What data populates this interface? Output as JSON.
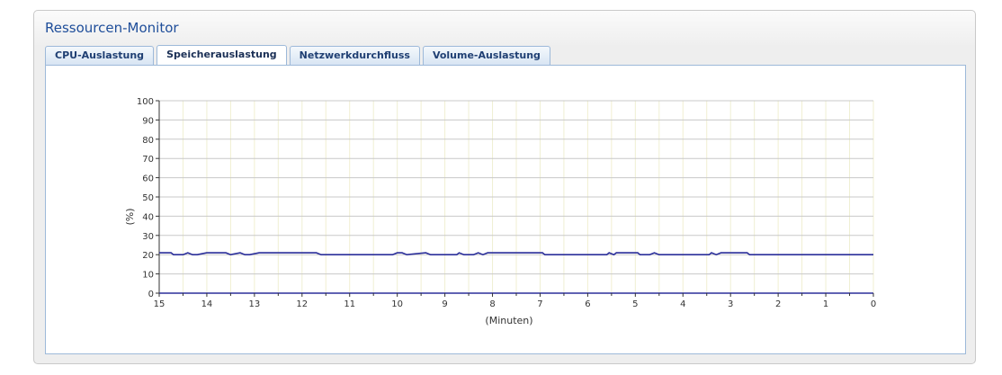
{
  "window": {
    "title": "Ressourcen-Monitor"
  },
  "tabs": [
    {
      "label": "CPU-Auslastung",
      "active": false
    },
    {
      "label": "Speicherauslastung",
      "active": true
    },
    {
      "label": "Netzwerkdurchfluss",
      "active": false
    },
    {
      "label": "Volume-Auslastung",
      "active": false
    }
  ],
  "colors": {
    "line": "#2b2f9a",
    "title": "#1f4e9a",
    "grid": "#c8c8c8",
    "vgrid": "#f0efd2"
  },
  "chart_data": {
    "type": "line",
    "xlabel": "(Minuten)",
    "ylabel": "(%)",
    "xlim": [
      15,
      0
    ],
    "ylim": [
      0,
      100
    ],
    "x_ticks": [
      15,
      14,
      13,
      12,
      11,
      10,
      9,
      8,
      7,
      6,
      5,
      4,
      3,
      2,
      1,
      0
    ],
    "y_ticks": [
      0,
      10,
      20,
      30,
      40,
      50,
      60,
      70,
      80,
      90,
      100
    ],
    "grid": true,
    "series": [
      {
        "x": [
          15,
          14.75,
          14.7,
          14.5,
          14.4,
          14.3,
          14.2,
          14.0,
          13.6,
          13.5,
          13.3,
          13.2,
          13.1,
          12.9,
          12.6,
          11.7,
          11.6,
          10.1,
          10.0,
          9.9,
          9.8,
          9.4,
          9.3,
          8.75,
          8.7,
          8.6,
          8.4,
          8.3,
          8.2,
          8.1,
          6.95,
          6.9,
          5.6,
          5.55,
          5.45,
          5.4,
          4.95,
          4.9,
          4.7,
          4.6,
          4.5,
          4.4,
          3.45,
          3.4,
          3.3,
          3.2,
          2.65,
          2.6,
          0
        ],
        "y": [
          21,
          21,
          20,
          20,
          21,
          20,
          20,
          21,
          21,
          20,
          21,
          20,
          20,
          21,
          21,
          21,
          20,
          20,
          21,
          21,
          20,
          21,
          20,
          20,
          21,
          20,
          20,
          21,
          20,
          21,
          21,
          20,
          20,
          21,
          20,
          21,
          21,
          20,
          20,
          21,
          20,
          20,
          20,
          21,
          20,
          21,
          21,
          20,
          20
        ]
      }
    ]
  }
}
